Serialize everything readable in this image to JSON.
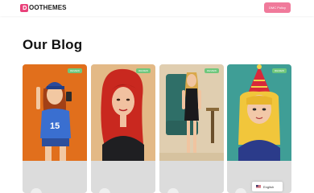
{
  "header": {
    "logo_text": "OOTHEMES",
    "logo_mark_color": "#e9417a",
    "cta_label": "DMC Policy",
    "cta_color": "#f07a9b"
  },
  "main": {
    "title": "Our Blog"
  },
  "posts": [
    {
      "badge": "REVIEW",
      "image": "cartoon girl in blue cap holding phone, jersey 15",
      "bg_color": "#e6751e"
    },
    {
      "badge": "REVIEW",
      "image": "cartoon woman with long red hair",
      "bg_color": "#e3b986"
    },
    {
      "badge": "REVIEW",
      "image": "cartoon blonde woman in black dress beside chair",
      "bg_color": "#e0ceb0"
    },
    {
      "badge": "REVIEW",
      "image": "cartoon girl with bangs wearing party hat",
      "bg_color": "#3f9e96"
    }
  ],
  "language": {
    "label": "English",
    "flag_icon": "us-flag-icon"
  }
}
